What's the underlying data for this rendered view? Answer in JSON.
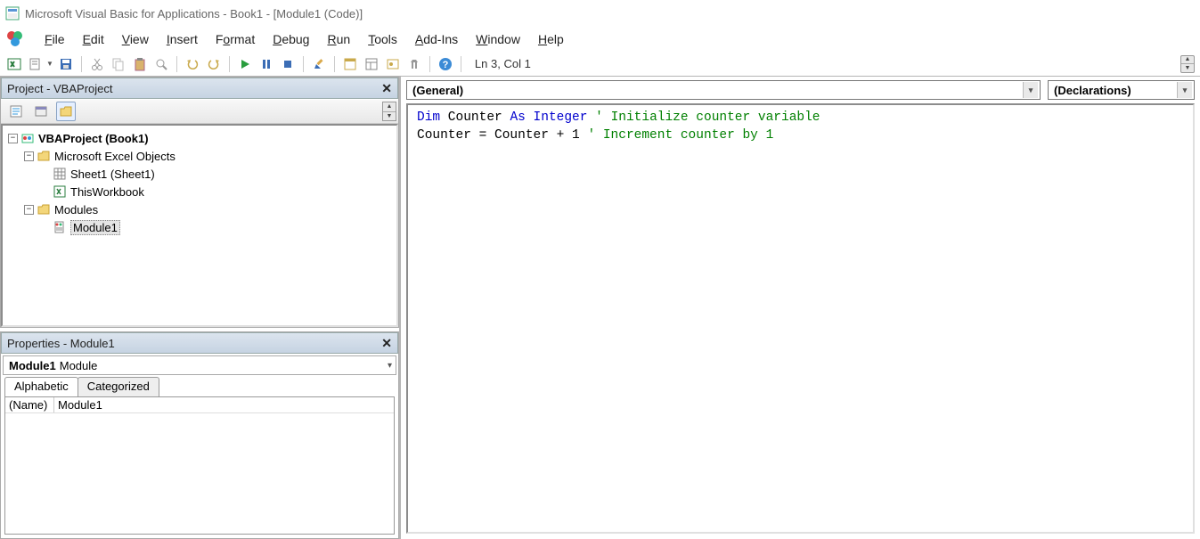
{
  "titlebar": {
    "text": "Microsoft Visual Basic for Applications - Book1 - [Module1 (Code)]"
  },
  "menu": {
    "file": "File",
    "edit": "Edit",
    "view": "View",
    "insert": "Insert",
    "format": "Format",
    "debug": "Debug",
    "run": "Run",
    "tools": "Tools",
    "addins": "Add-Ins",
    "window": "Window",
    "help": "Help"
  },
  "toolbar": {
    "cursor_pos": "Ln 3, Col 1"
  },
  "project_panel": {
    "title": "Project - VBAProject",
    "root": "VBAProject (Book1)",
    "excel_objects": "Microsoft Excel Objects",
    "sheet1": "Sheet1 (Sheet1)",
    "thisworkbook": "ThisWorkbook",
    "modules": "Modules",
    "module1": "Module1"
  },
  "props_panel": {
    "title": "Properties - Module1",
    "object_name": "Module1",
    "object_type": "Module",
    "tab_alpha": "Alphabetic",
    "tab_cat": "Categorized",
    "prop_name_label": "(Name)",
    "prop_name_value": "Module1"
  },
  "code": {
    "object_dd": "(General)",
    "proc_dd": "(Declarations)",
    "line1_kw1": "Dim",
    "line1_mid": " Counter ",
    "line1_kw2": "As",
    "line1_kw3": " Integer",
    "line1_cm": " ' Initialize counter variable",
    "line2_txt": "Counter = Counter + 1 ",
    "line2_cm": "' Increment counter by 1"
  }
}
